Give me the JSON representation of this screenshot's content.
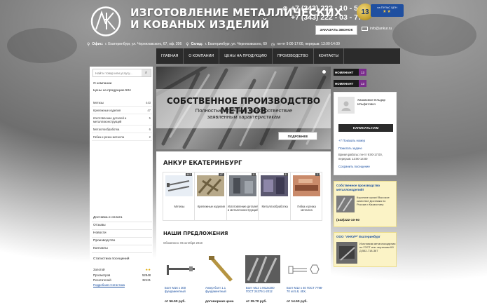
{
  "header": {
    "title_line1": "ИЗГОТОВЛЕНИЕ МЕТАЛЛИЧЕСКИХ",
    "title_line2": "И КОВАНЫХ ИЗДЕЛИЙ",
    "phone1": "+7 (343) 222 - 10 - 50",
    "phone2": "+7 (343) 222 - 03 - 77",
    "badge_years": "13",
    "badge_text": "на ПУЛЬС ЦЕН",
    "badge_stars": "★★",
    "order_call": "ЗАКАЗАТЬ ЗВОНОК",
    "email": "info@ankur.ru",
    "office_label": "Офис:",
    "office_addr": "г. Екатеринбург, ул. Черняховского, 67, оф. 206",
    "warehouse_label": "Склад:",
    "warehouse_addr": "г. Екатеринбург, ул. Черняховского, 69",
    "hours": "пн-пт 9:00-17:00, перерыв: 13:00-14:00"
  },
  "nav": [
    "ГЛАВНАЯ",
    "О КОМПАНИИ",
    "ЦЕНЫ НА ПРОДУКЦИЮ",
    "ПРОИЗВОДСТВО",
    "КОНТАКТЫ"
  ],
  "sidebar": {
    "search_placeholder": "Найти товар или услугу...",
    "company": "О компании",
    "prices": "Цены на продукцию 504",
    "categories": [
      {
        "name": "Метизы",
        "count": "443"
      },
      {
        "name": "Крепежные изделия",
        "count": "47"
      },
      {
        "name": "Изготовление деталей и металлоконструкций",
        "count": "5"
      },
      {
        "name": "Металлообработка",
        "count": "6"
      },
      {
        "name": "Гибка и резка металла",
        "count": "2"
      }
    ],
    "menu": [
      "Доставка и оплата",
      "Отзывы",
      "Новости",
      "Производство",
      "Контакты"
    ],
    "stats_title": "Статистика посещений",
    "stats": [
      {
        "label": "Золотой",
        "value": "★★"
      },
      {
        "label": "Просмотров",
        "value": "52948"
      },
      {
        "label": "Посетителей",
        "value": "32121"
      }
    ],
    "stats_link": "Подробная статистика"
  },
  "banner": {
    "heading": "СОБСТВЕННОЕ ПРОИЗВОДСТВО МЕТИЗОВ",
    "sub1": "Полностью отвечаем за их соотвествие",
    "sub2": "заявленным характеристикам",
    "button": "ПОДРОБНЕЕ"
  },
  "company": {
    "heading": "АНКУР ЕКАТЕРИНБУРГ",
    "tiles": [
      {
        "label": "Метизы",
        "badge": "443"
      },
      {
        "label": "Крепежные изделия",
        "badge": "47"
      },
      {
        "label": "Изготовление деталей и металлоконструкций",
        "badge": "5"
      },
      {
        "label": "Металлообработка",
        "badge": "6"
      },
      {
        "label": "Гибка и резка металла",
        "badge": "2"
      }
    ]
  },
  "offers": {
    "heading": "НАШИ ПРЕДЛОЖЕНИЯ",
    "updated": "Обновлено: 05 октября 2018",
    "products": [
      {
        "name": "Болт М16 х 300 фундаментный",
        "price": "от 56.50 руб."
      },
      {
        "name": "Анкер-болт 1.1 фундаментный",
        "price": "договорная цена"
      },
      {
        "name": "Болт М12 1 М12х300 ГОСТ 24379.1-2012",
        "price": "от 39.70 руб."
      },
      {
        "name": "Болт М12 х 40 ГОСТ 7798-70 кл.5.8, 45Х,",
        "price": "от 14.50 руб."
      }
    ]
  },
  "right": {
    "badge1": "НОМИНАНТ",
    "badge1_num": "13",
    "badge2": "НОМИНАНТ",
    "badge2_num": "13",
    "manager_name": "Хазиахмое Ильдар Ильфатович",
    "write_btn": "НАПИСАТЬ НАМ",
    "show_phone": "+7 Показать номер",
    "ask": "Помогать задаче",
    "hours": "Время работы: пн-пт 9:00-17:00, перерыв: 13:00-14:00",
    "save": "Сохранить посещение",
    "promo1_title": "Собственное производство металлоизделий!",
    "promo1_text": "Короткие сроки! Высокое качество! Доставка по России и Казахстану",
    "promo1_phone": "(343)222-10-50",
    "promo2_title": "ООО \"АНКУР\" Екатеринбург",
    "promo2_text": "Изготовим металлоизделия по ГОСТ или чертежам Ю/Д:552-718-367"
  }
}
